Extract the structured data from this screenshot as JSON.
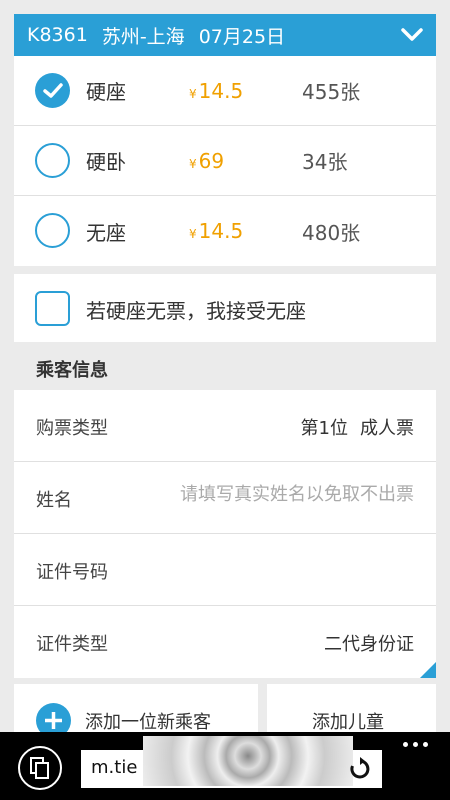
{
  "header": {
    "train_no": "K8361",
    "route": "苏州-上海",
    "date": "07月25日"
  },
  "seats": [
    {
      "name": "硬座",
      "price": "14.5",
      "count": "455张",
      "selected": true
    },
    {
      "name": "硬卧",
      "price": "69",
      "count": "34张",
      "selected": false
    },
    {
      "name": "无座",
      "price": "14.5",
      "count": "480张",
      "selected": false
    }
  ],
  "currency": "¥",
  "accept_no_seat": {
    "label": "若硬座无票，我接受无座",
    "checked": false
  },
  "passenger": {
    "title": "乘客信息",
    "ticket_type_label": "购票类型",
    "position": "第1位",
    "ticket_type": "成人票",
    "name_label": "姓名",
    "name_placeholder": "请填写真实姓名以免取不出票",
    "id_number_label": "证件号码",
    "id_type_label": "证件类型",
    "id_type": "二代身份证"
  },
  "actions": {
    "add_passenger": "添加一位新乘客",
    "add_child": "添加儿童"
  },
  "browser": {
    "url": "m.tie"
  },
  "colors": {
    "accent": "#2a9fd6",
    "price": "#f0a000"
  }
}
